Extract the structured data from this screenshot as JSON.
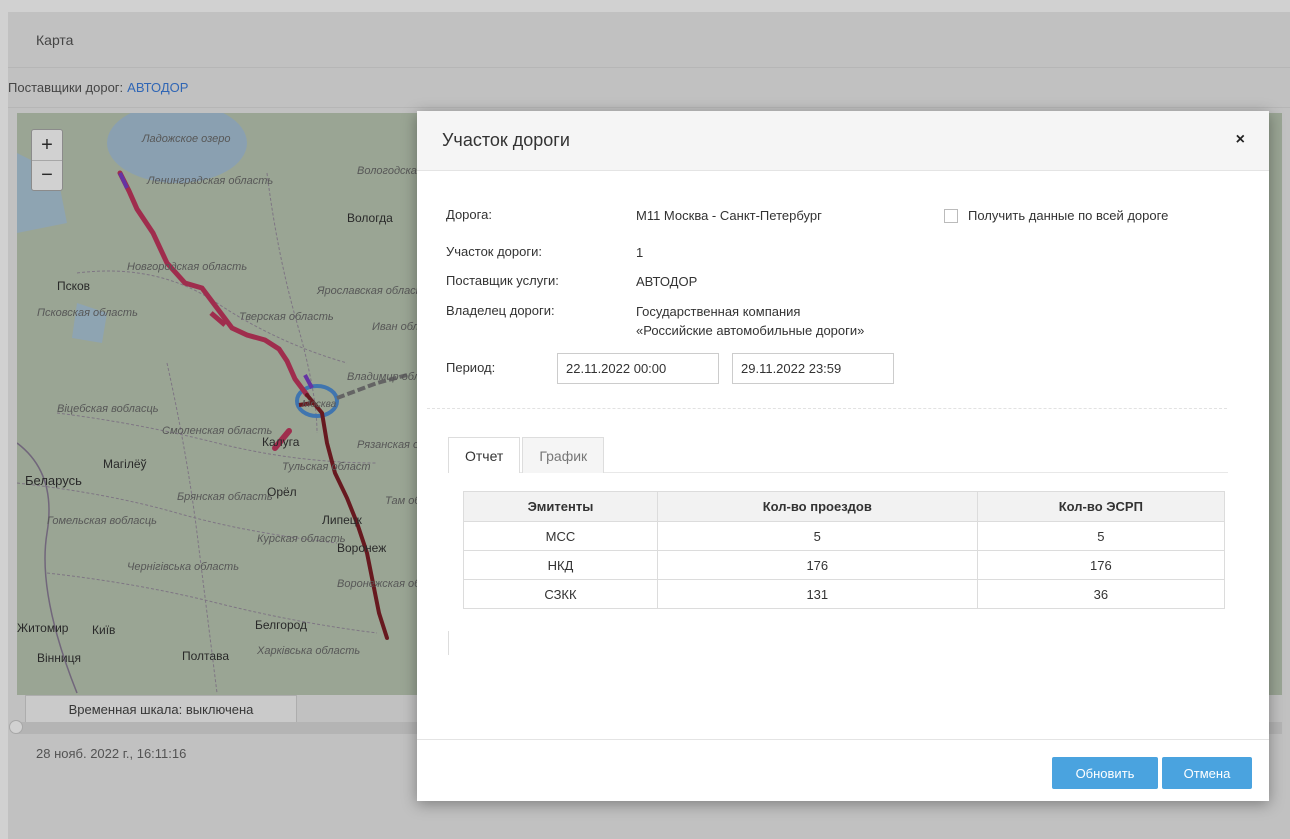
{
  "page": {
    "title": "Карта",
    "providers_label": "Поставщики дорог:",
    "providers_value": "АВТОДОР",
    "timeline_label": "Временная шкала: выключена",
    "timestamp": "28 нояб. 2022 г., 16:11:16",
    "zoom_in": "+",
    "zoom_out": "−"
  },
  "map": {
    "labels": {
      "ladoga": "Ладожское озеро",
      "leningrad_region": "Ленинградская область",
      "vologda_region": "Вологодская область",
      "vologda": "Вологда",
      "novgorod_region": "Новгородская область",
      "pskov": "Псков",
      "pskov_region": "Псковская область",
      "yaroslavl_region": "Ярославская область",
      "tver_region": "Тверская область",
      "ivanovo": "Иван обл",
      "vitebsk_region": "Віцебская вобласць",
      "smolensk_region": "Смоленская область",
      "kaluga": "Калуга",
      "ryazan_region": "Рязанская област",
      "tula_region": "Тульская област",
      "mogilev": "Магілёў",
      "belarus": "Беларусь",
      "bryansk_region": "Брянская область",
      "orel": "Орёл",
      "tambov": "Там об",
      "gomel_region": "Гомельская вобласць",
      "lipetsk": "Липецк",
      "kursk_region": "Курская область",
      "voronezh": "Воронеж",
      "chernigov_region": "Чернігівська область",
      "voronezh_region": "Воронежская область",
      "zhytomyr": "Житомир",
      "kyiv": "Київ",
      "belgorod": "Белгород",
      "vinnytsia": "Вінниця",
      "poltava": "Полтава",
      "kharkiv_region": "Харківська область",
      "moscow": "Москва",
      "vladimir": "Владимир обла"
    }
  },
  "modal": {
    "title": "Участок дороги",
    "close": "×",
    "road_label": "Дорога:",
    "road_value": "М11 Москва - Санкт-Петербург",
    "segment_label": "Участок дороги:",
    "segment_value": "1",
    "provider_label": "Поставщик услуги:",
    "provider_value": "АВТОДОР",
    "owner_label": "Владелец дороги:",
    "owner_value_line1": "Государственная компания",
    "owner_value_line2": "«Российские автомобильные дороги»",
    "whole_road_label": "Получить данные по всей дороге",
    "period_label": "Период:",
    "period_from": "22.11.2022 00:00",
    "period_to": "29.11.2022 23:59",
    "tabs": [
      {
        "label": "Отчет",
        "active": true
      },
      {
        "label": "График",
        "active": false
      }
    ],
    "table": {
      "headers": [
        "Эмитенты",
        "Кол-во проездов",
        "Кол-во ЭСРП"
      ],
      "rows": [
        [
          "МСС",
          "5",
          "5"
        ],
        [
          "НКД",
          "176",
          "176"
        ],
        [
          "СЗКК",
          "131",
          "36"
        ]
      ]
    },
    "refresh_button": "Обновить",
    "cancel_button": "Отмена"
  },
  "colors": {
    "accent": "#4aa3df",
    "link": "#3b7ddd",
    "road_primary": "#c2375f",
    "road_dark": "#7e1f26",
    "road_purple": "#7c3fc7",
    "ring": "#4f8fd6"
  }
}
